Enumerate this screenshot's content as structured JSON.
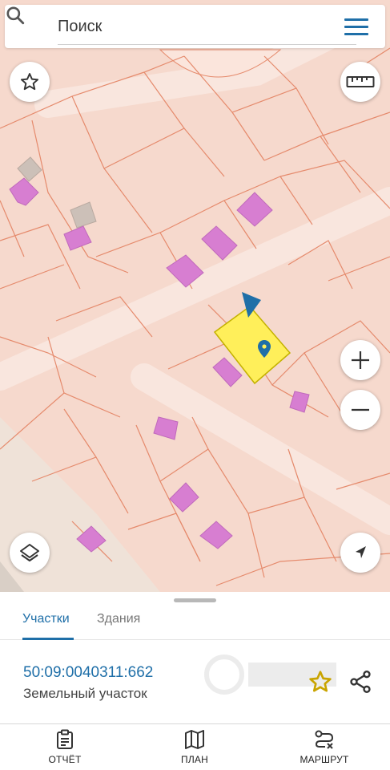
{
  "search": {
    "placeholder": "Поиск"
  },
  "map": {
    "colors": {
      "background": "#f6d9cd",
      "boundary": "#e58a6c",
      "building": "#d77ed1",
      "selected": "#ffef5a",
      "accent": "#1f6fa8"
    }
  },
  "map_controls": {
    "favorites": "star-icon",
    "ruler": "ruler-icon",
    "zoom_in": "plus-icon",
    "zoom_out": "minus-icon",
    "layers": "layers-icon",
    "locate": "navigation-arrow-icon"
  },
  "tabs": [
    {
      "label": "Участки",
      "active": true
    },
    {
      "label": "Здания",
      "active": false
    }
  ],
  "parcel": {
    "cadastral_number": "50:09:0040311:662",
    "type": "Земельный участок"
  },
  "bottom_nav": [
    {
      "label": "ОТЧЁТ",
      "icon": "report-icon"
    },
    {
      "label": "ПЛАН",
      "icon": "map-icon"
    },
    {
      "label": "МАРШРУТ",
      "icon": "route-icon"
    }
  ]
}
